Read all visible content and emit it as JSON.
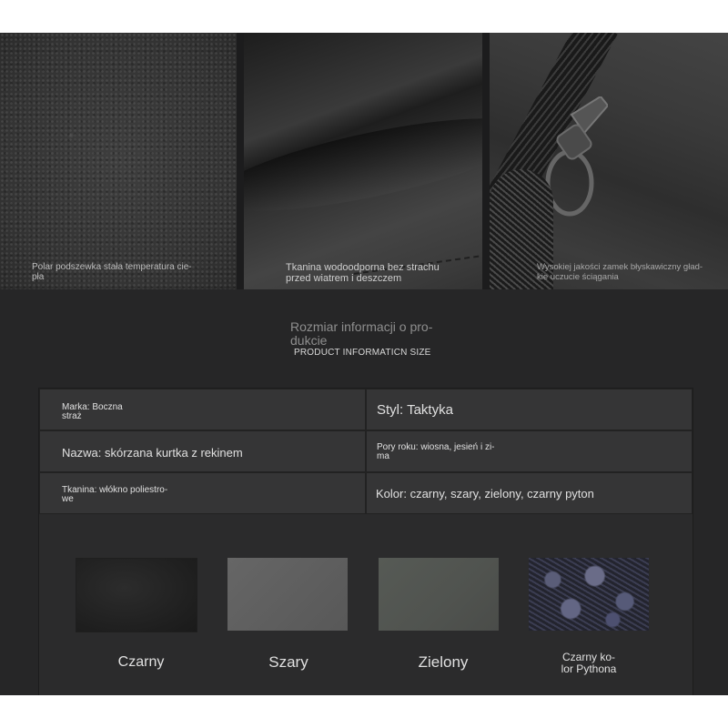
{
  "photos": {
    "caption_1_line1": "Polar podszewka stała temperatura cie-",
    "caption_1_line2": "pła",
    "caption_2_line1": "Tkanina wodoodporna bez strachu",
    "caption_2_line2": "przed wiatrem i deszczem",
    "caption_3_line1": "Wysokiej jakości zamek błyskawiczny gład-",
    "caption_3_line2": "kie uczucie ściągania"
  },
  "heading": {
    "pl_line1": "Rozmiar informacji o pro-",
    "pl_line2": "dukcie",
    "en": "PRODUCT INFORMATICN SIZE"
  },
  "table": {
    "brand_line1": "Marka: Boczna",
    "brand_line2": "straż",
    "style": "Styl: Taktyka",
    "name": "Nazwa: skórzana kurtka z rekinem",
    "seasons_line1": "Pory roku: wiosna, jesień i zi-",
    "seasons_line2": "ma",
    "fabric_line1": "Tkanina: włókno poliestro-",
    "fabric_line2": "we",
    "color": "Kolor: czarny, szary, zielony, czarny pyton"
  },
  "swatches": {
    "black": "Czarny",
    "grey": "Szary",
    "green": "Zielony",
    "python_line1": "Czarny ko-",
    "python_line2": "lor Pythona"
  },
  "colors": {
    "background": "#262627",
    "cell": "#353536",
    "text": "#e0e0e0"
  }
}
